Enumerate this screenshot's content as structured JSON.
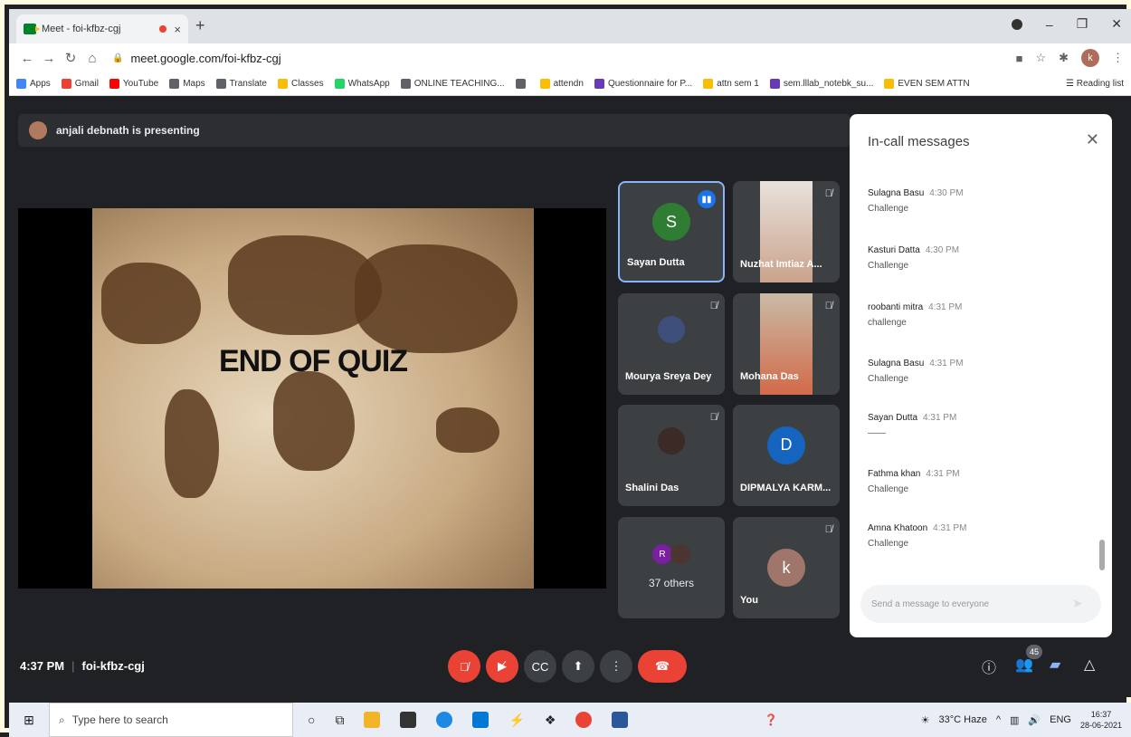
{
  "browser": {
    "tab_title": "Meet - foi-kfbz-cgj",
    "tab_close": "×",
    "new_tab": "+",
    "url": "meet.google.com/foi-kfbz-cgj",
    "profile_initial": "k",
    "bookmarks": [
      {
        "label": "Apps",
        "color": "#4285f4"
      },
      {
        "label": "Gmail",
        "color": "#ea4335"
      },
      {
        "label": "YouTube",
        "color": "#ff0000"
      },
      {
        "label": "Maps",
        "color": "#5f6368"
      },
      {
        "label": "Translate",
        "color": "#5f6368"
      },
      {
        "label": "Classes",
        "color": "#fbbc04"
      },
      {
        "label": "WhatsApp",
        "color": "#25d366"
      },
      {
        "label": "ONLINE TEACHING...",
        "color": "#5f6368"
      },
      {
        "label": "",
        "color": "#5f6368"
      },
      {
        "label": "attendn",
        "color": "#fbbc04"
      },
      {
        "label": "Questionnaire for P...",
        "color": "#673ab7"
      },
      {
        "label": "attn sem 1",
        "color": "#fbbc04"
      },
      {
        "label": "sem.lllab_notebk_su...",
        "color": "#673ab7"
      },
      {
        "label": "EVEN SEM ATTN",
        "color": "#fbbc04"
      }
    ],
    "reading_list": "Reading list"
  },
  "meet": {
    "presenting_banner": "anjali debnath is presenting",
    "slide_title": "END OF QUIZ",
    "tiles": [
      {
        "name": "Sayan Dutta",
        "initial": "S",
        "avatar_color": "#2e7d32"
      },
      {
        "name": "Nuzhat Imtiaz A..."
      },
      {
        "name": "Mourya Sreya Dey"
      },
      {
        "name": "Mohana Das"
      },
      {
        "name": "Shalini Das"
      },
      {
        "name": "DIPMALYA KARM...",
        "initial": "D",
        "avatar_color": "#1565c0"
      },
      {
        "name": "37 others",
        "initial": "R"
      },
      {
        "name": "You",
        "initial": "k",
        "avatar_color": "#a0766a"
      }
    ],
    "meeting_time": "4:37 PM",
    "meeting_code": "foi-kfbz-cgj",
    "participant_count": "45"
  },
  "chat": {
    "title": "In-call messages",
    "messages": [
      {
        "sender": "Sulagna Basu",
        "time": "4:30 PM",
        "text": "Challenge"
      },
      {
        "sender": "Kasturi Datta",
        "time": "4:30 PM",
        "text": "Challenge"
      },
      {
        "sender": "roobanti mitra",
        "time": "4:31 PM",
        "text": "challenge"
      },
      {
        "sender": "Sulagna Basu",
        "time": "4:31 PM",
        "text": "Challenge"
      },
      {
        "sender": "Sayan Dutta",
        "time": "4:31 PM",
        "text": "——"
      },
      {
        "sender": "Fathma khan",
        "time": "4:31 PM",
        "text": "Challenge"
      },
      {
        "sender": "Amna Khatoon",
        "time": "4:31 PM",
        "text": "Challenge"
      }
    ],
    "input_placeholder": "Send a message to everyone"
  },
  "taskbar": {
    "search_placeholder": "Type here to search",
    "weather": "33°C Haze",
    "language": "ENG",
    "time": "16:37",
    "date": "28-06-2021"
  }
}
